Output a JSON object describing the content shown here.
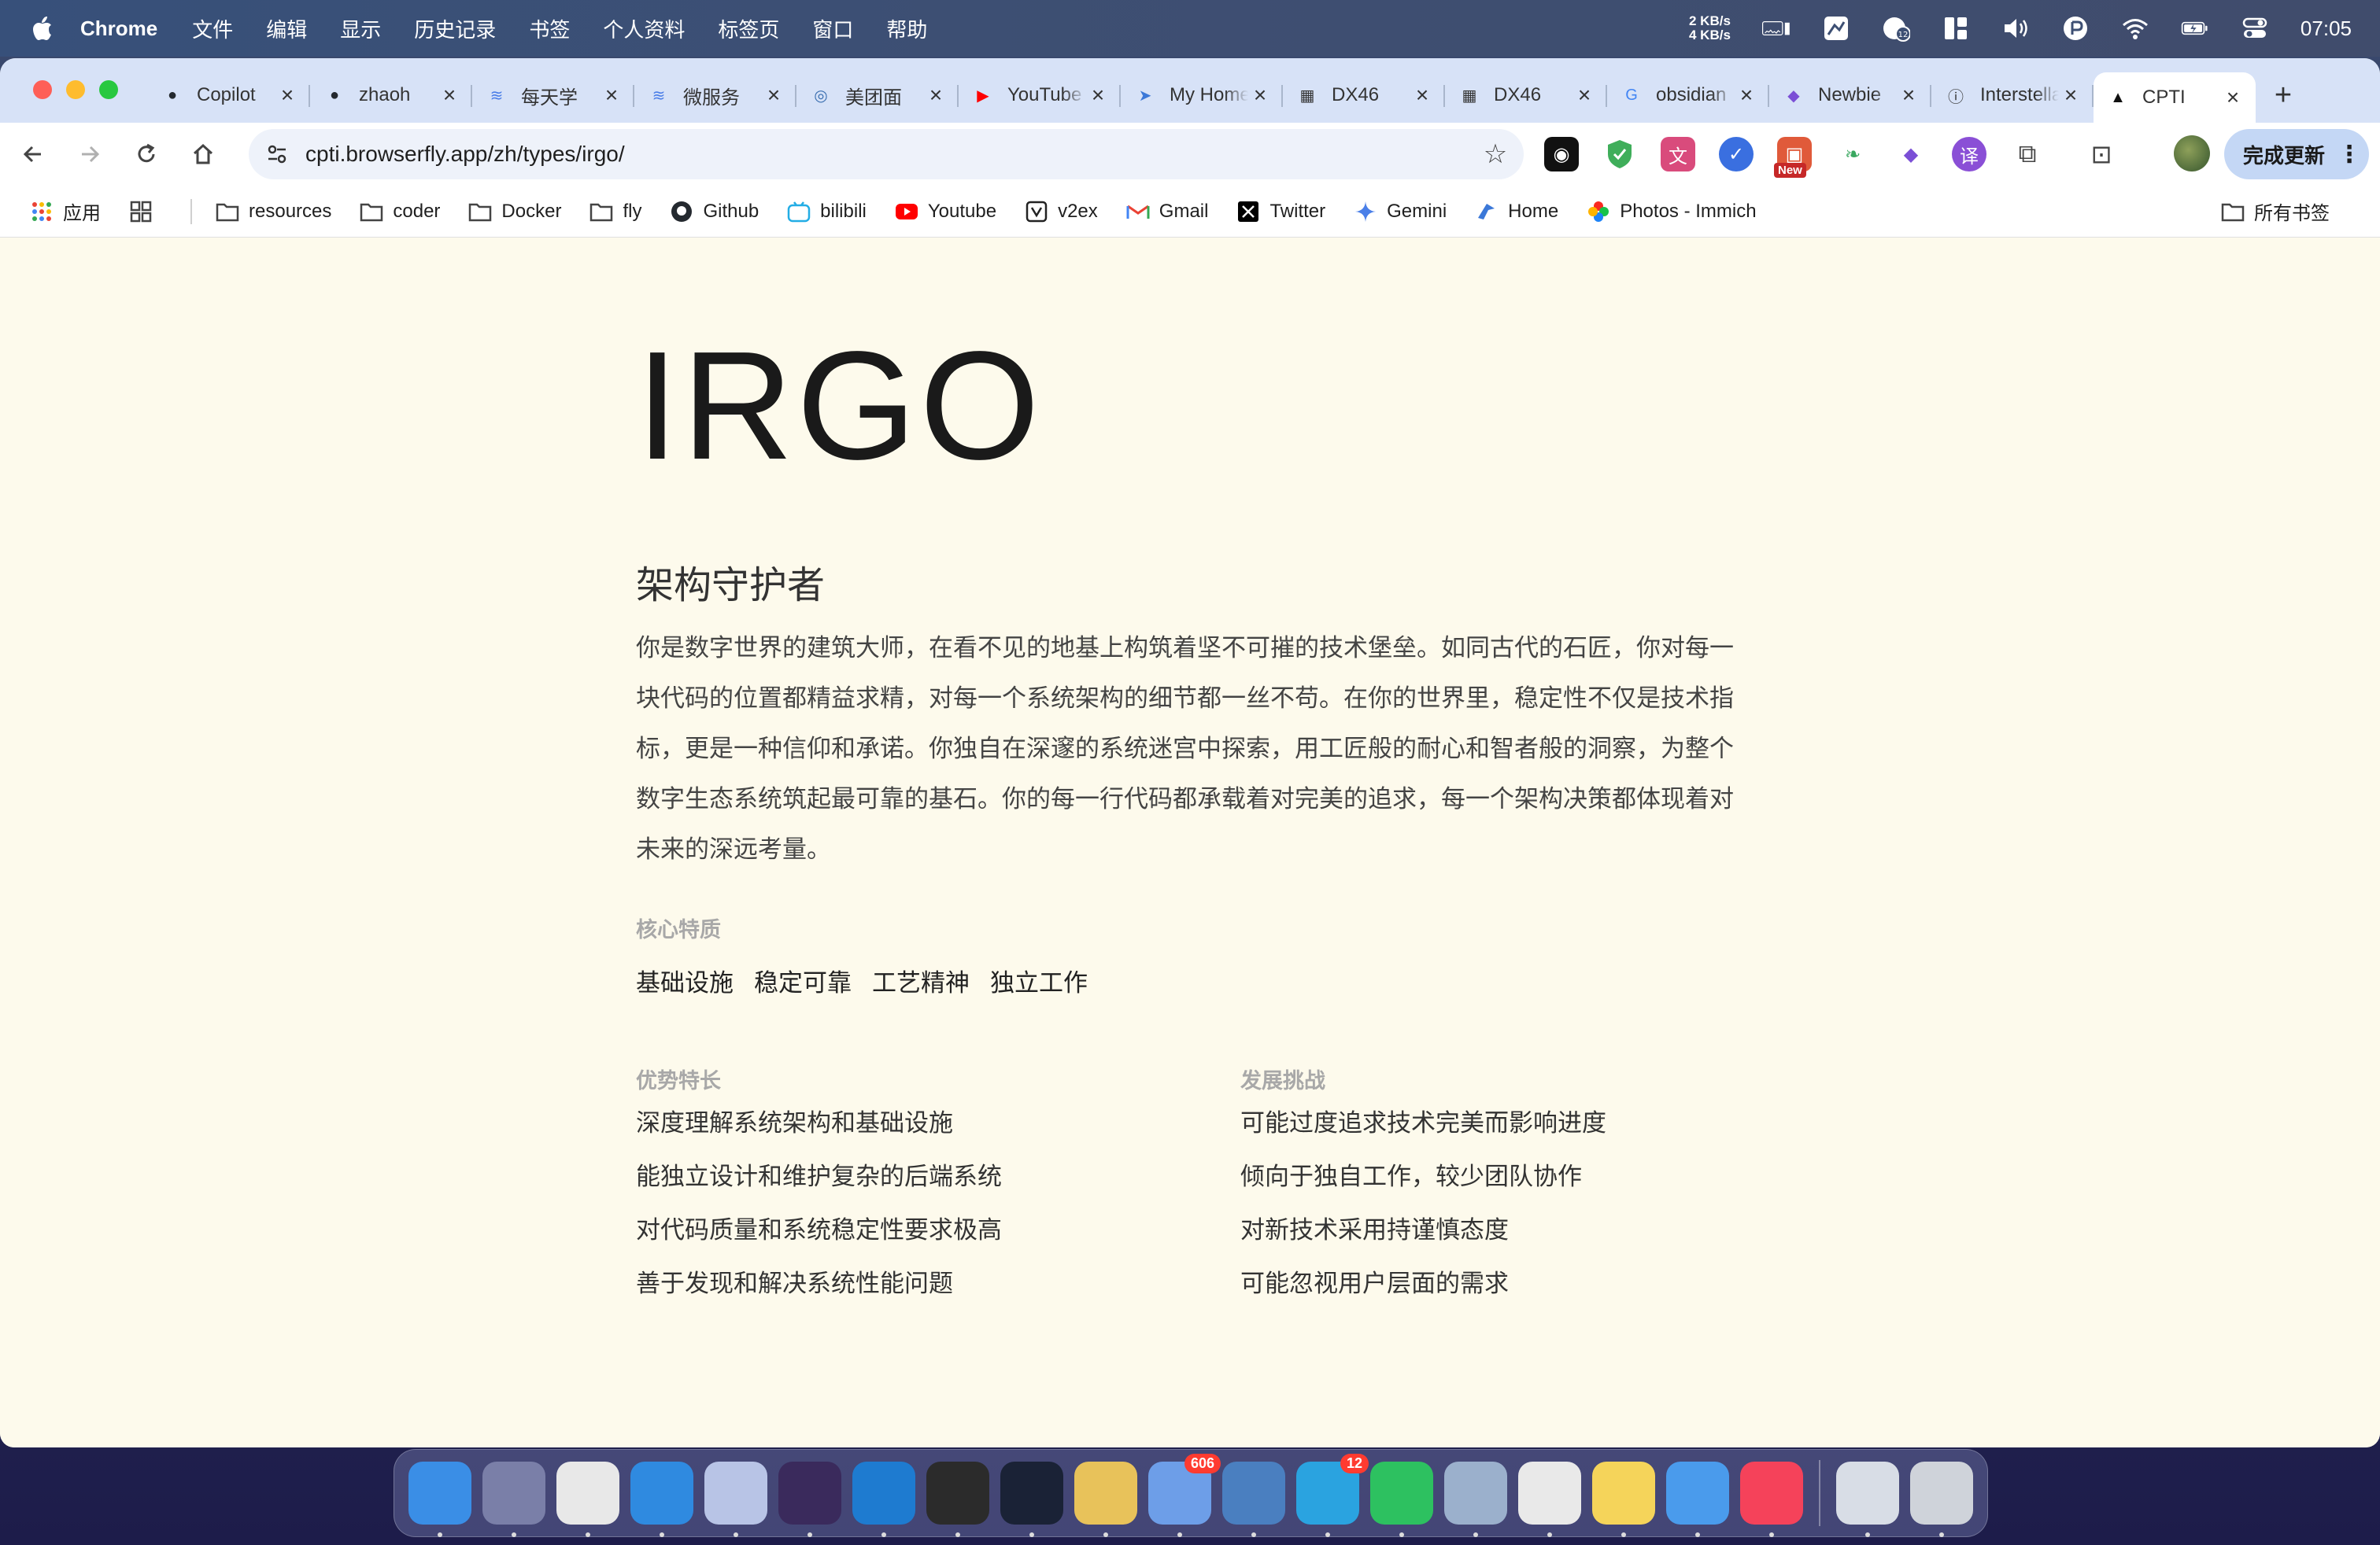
{
  "menubar": {
    "app_name": "Chrome",
    "menus": [
      "文件",
      "编辑",
      "显示",
      "历史记录",
      "书签",
      "个人资料",
      "标签页",
      "窗口",
      "帮助"
    ],
    "net_up": "2 KB/s",
    "net_down": "4 KB/s",
    "clock": "07:05"
  },
  "tabs": [
    {
      "title": "Copilot",
      "icon": "github-icon",
      "color": "#24292f"
    },
    {
      "title": "zhaoh",
      "icon": "github-icon",
      "color": "#24292f"
    },
    {
      "title": "每天学",
      "icon": "stack-icon",
      "color": "#4a7de8"
    },
    {
      "title": "微服务",
      "icon": "stack-icon",
      "color": "#4a7de8"
    },
    {
      "title": "美团面",
      "icon": "copilot-icon",
      "color": "#3b6fb0"
    },
    {
      "title": "YouTube",
      "icon": "youtube-icon",
      "color": "#ff0000"
    },
    {
      "title": "My Home",
      "icon": "bird-icon",
      "color": "#3b78d8"
    },
    {
      "title": "DX46",
      "icon": "chip-icon",
      "color": "#333333"
    },
    {
      "title": "DX46",
      "icon": "chip-icon",
      "color": "#333333"
    },
    {
      "title": "obsidian",
      "icon": "google-icon",
      "color": "#4285f4"
    },
    {
      "title": "Newbie",
      "icon": "obsidian-icon",
      "color": "#7b4fd6"
    },
    {
      "title": "Interstellar",
      "icon": "info-icon",
      "color": "#333333"
    },
    {
      "title": "CPTI",
      "icon": "cpti-icon",
      "color": "#111111"
    }
  ],
  "active_tab_index": 12,
  "toolbar": {
    "url": "cpti.browserfly.app/zh/types/irgo/",
    "update_label": "完成更新",
    "new_badge": "New"
  },
  "bookmarks": {
    "apps_label": "应用",
    "items": [
      {
        "label": "resources",
        "icon": "folder-icon"
      },
      {
        "label": "coder",
        "icon": "folder-icon"
      },
      {
        "label": "Docker",
        "icon": "folder-icon"
      },
      {
        "label": "fly",
        "icon": "folder-icon"
      },
      {
        "label": "Github",
        "icon": "github-icon"
      },
      {
        "label": "bilibili",
        "icon": "bilibili-icon"
      },
      {
        "label": "Youtube",
        "icon": "youtube-icon"
      },
      {
        "label": "v2ex",
        "icon": "v2ex-icon"
      },
      {
        "label": "Gmail",
        "icon": "gmail-icon"
      },
      {
        "label": "Twitter",
        "icon": "x-icon"
      },
      {
        "label": "Gemini",
        "icon": "gemini-icon"
      },
      {
        "label": "Home",
        "icon": "bird-icon"
      },
      {
        "label": "Photos - Immich",
        "icon": "immich-icon"
      }
    ],
    "all_label": "所有书签"
  },
  "page": {
    "code": "IRGO",
    "name": "架构守护者",
    "description": "你是数字世界的建筑大师，在看不见的地基上构筑着坚不可摧的技术堡垒。如同古代的石匠，你对每一块代码的位置都精益求精，对每一个系统架构的细节都一丝不苟。在你的世界里，稳定性不仅是技术指标，更是一种信仰和承诺。你独自在深邃的系统迷宫中探索，用工匠般的耐心和智者般的洞察，为整个数字生态系统筑起最可靠的基石。你的每一行代码都承载着对完美的追求，每一个架构决策都体现着对未来的深远考量。",
    "traits_label": "核心特质",
    "traits": [
      "基础设施",
      "稳定可靠",
      "工艺精神",
      "独立工作"
    ],
    "strengths_label": "优势特长",
    "strengths": [
      "深度理解系统架构和基础设施",
      "能独立设计和维护复杂的后端系统",
      "对代码质量和系统稳定性要求极高",
      "善于发现和解决系统性能问题"
    ],
    "challenges_label": "发展挑战",
    "challenges": [
      "可能过度追求技术完美而影响进度",
      "倾向于独自工作，较少团队协作",
      "对新技术采用持谨慎态度",
      "可能忽视用户层面的需求"
    ]
  },
  "dock": {
    "apps": [
      {
        "name": "finder",
        "color": "#3a8ee6"
      },
      {
        "name": "launchpad",
        "color": "#7a7fa8"
      },
      {
        "name": "chrome",
        "color": "#e8e8e8"
      },
      {
        "name": "safari",
        "color": "#2f8ae0"
      },
      {
        "name": "instruments",
        "color": "#b8c4e6"
      },
      {
        "name": "obsidian",
        "color": "#3a2a5c"
      },
      {
        "name": "vscode",
        "color": "#1e7bd0"
      },
      {
        "name": "unity",
        "color": "#2b2b2b"
      },
      {
        "name": "warp",
        "color": "#1a2236"
      },
      {
        "name": "tableplus",
        "color": "#e8c25a"
      },
      {
        "name": "xcode",
        "color": "#6d9ee8",
        "badge": "606"
      },
      {
        "name": "dictionary",
        "color": "#4a7fc0"
      },
      {
        "name": "telegram",
        "color": "#2aa3e0",
        "badge": "12"
      },
      {
        "name": "wechat",
        "color": "#2dc160"
      },
      {
        "name": "preview",
        "color": "#9bb0cc"
      },
      {
        "name": "textedit",
        "color": "#e9e9e9"
      },
      {
        "name": "notes",
        "color": "#f5d45a"
      },
      {
        "name": "finder-2",
        "color": "#4a9bec"
      },
      {
        "name": "music",
        "color": "#f5425a"
      }
    ],
    "trailing": [
      {
        "name": "downloads-stack",
        "color": "#d8dde6"
      },
      {
        "name": "trash",
        "color": "#cfd3da"
      }
    ]
  }
}
